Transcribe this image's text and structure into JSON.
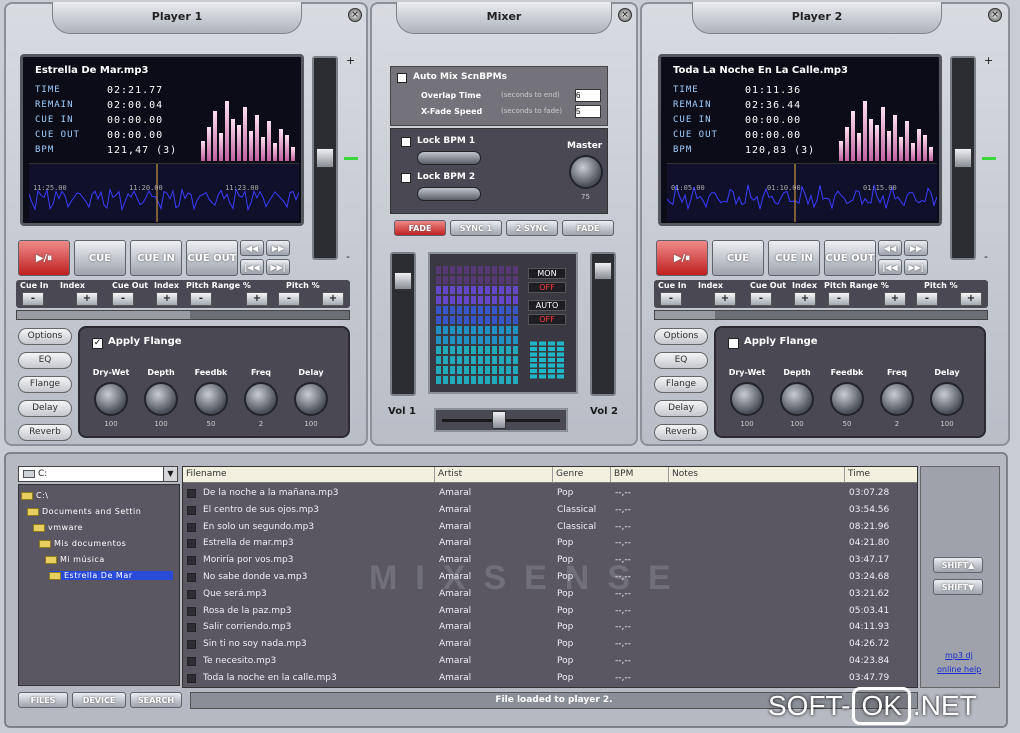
{
  "player1": {
    "title": "Player 1",
    "track": "Estrella De Mar.mp3",
    "rows": [
      {
        "label": "TIME",
        "value": "02:21.77"
      },
      {
        "label": "REMAIN",
        "value": "02:00.04"
      },
      {
        "label": "CUE IN",
        "value": "00:00.00"
      },
      {
        "label": "CUE OUT",
        "value": "00:00.00"
      },
      {
        "label": "BPM",
        "value": "121,47 (3)"
      }
    ],
    "wave_ticks": [
      "11:25.00",
      "11:20.00",
      "11:23.00"
    ],
    "apply_flange": "Apply Flange",
    "flange_checked": true
  },
  "player2": {
    "title": "Player 2",
    "track": "Toda La Noche En La Calle.mp3",
    "rows": [
      {
        "label": "TIME",
        "value": "01:11.36"
      },
      {
        "label": "REMAIN",
        "value": "02:36.44"
      },
      {
        "label": "CUE IN",
        "value": "00:00.00"
      },
      {
        "label": "CUE OUT",
        "value": "00:00.00"
      },
      {
        "label": "BPM",
        "value": "120,83 (3)"
      }
    ],
    "wave_ticks": [
      "01:05.00",
      "01:10.00",
      "01:15.00"
    ],
    "apply_flange": "Apply Flange",
    "flange_checked": false
  },
  "transport": {
    "play": "▶/⏸",
    "cue": "CUE",
    "cue_in": "CUE IN",
    "cue_out": "CUE OUT",
    "cue_in_label": "Cue In",
    "index_label": "Index",
    "cue_out_label": "Cue Out",
    "pitch_range_label": "Pitch Range %",
    "pitch_label": "Pitch %",
    "minus": "-",
    "plus": "+"
  },
  "effects": [
    "Options",
    "EQ",
    "Flange",
    "Delay",
    "Reverb"
  ],
  "knobs": [
    {
      "label": "Dry-Wet",
      "value": "100"
    },
    {
      "label": "Depth",
      "value": "100"
    },
    {
      "label": "Feedbk",
      "value": "50"
    },
    {
      "label": "Freq",
      "value": "2"
    },
    {
      "label": "Delay",
      "value": "100"
    }
  ],
  "mixer": {
    "title": "Mixer",
    "auto_mix": "Auto Mix ScnBPMs",
    "overlap_time": "Overlap Time",
    "overlap_hint": "(seconds to end)",
    "xfade_speed": "X-Fade Speed",
    "xfade_hint": "(seconds to fade)",
    "overlap_value": "6",
    "xfade_value": "5",
    "lock_bpm1": "Lock BPM 1",
    "lock_bpm2": "Lock BPM 2",
    "master": "Master",
    "master_value": "75",
    "fade_left": "FADE",
    "sync1": "SYNC 1",
    "sync2": "2 SYNC",
    "fade_right": "FADE",
    "mon": "MON",
    "off1": "OFF",
    "auto": "AUTO",
    "off2": "OFF",
    "vol1": "Vol 1",
    "vol2": "Vol 2"
  },
  "drive": "C:",
  "tree": [
    "C:\\",
    "Documents and Settin",
    "vmware",
    "Mis documentos",
    "Mi música",
    "Estrella De Mar"
  ],
  "columns": [
    "Filename",
    "Artist",
    "Genre",
    "BPM",
    "Notes",
    "Time"
  ],
  "tracks": [
    {
      "file": "De la noche a la mañana.mp3",
      "artist": "Amaral",
      "genre": "Pop",
      "bpm": "--,--",
      "time": "03:07.28"
    },
    {
      "file": "El centro de sus ojos.mp3",
      "artist": "Amaral",
      "genre": "Classical",
      "bpm": "--,--",
      "time": "03:54.56"
    },
    {
      "file": "En solo un segundo.mp3",
      "artist": "Amaral",
      "genre": "Classical",
      "bpm": "--,--",
      "time": "08:21.96"
    },
    {
      "file": "Estrella de mar.mp3",
      "artist": "Amaral",
      "genre": "Pop",
      "bpm": "--,--",
      "time": "04:21.80"
    },
    {
      "file": "Moriría por vos.mp3",
      "artist": "Amaral",
      "genre": "Pop",
      "bpm": "--,--",
      "time": "03:47.17"
    },
    {
      "file": "No sabe donde va.mp3",
      "artist": "Amaral",
      "genre": "Pop",
      "bpm": "--,--",
      "time": "03:24.68"
    },
    {
      "file": "Que será.mp3",
      "artist": "Amaral",
      "genre": "Pop",
      "bpm": "--,--",
      "time": "03:21.62"
    },
    {
      "file": "Rosa de la paz.mp3",
      "artist": "Amaral",
      "genre": "Pop",
      "bpm": "--,--",
      "time": "05:03.41"
    },
    {
      "file": "Salir corriendo.mp3",
      "artist": "Amaral",
      "genre": "Pop",
      "bpm": "--,--",
      "time": "04:11.93"
    },
    {
      "file": "Sin ti no soy nada.mp3",
      "artist": "Amaral",
      "genre": "Pop",
      "bpm": "--,--",
      "time": "04:26.72"
    },
    {
      "file": "Te necesito.mp3",
      "artist": "Amaral",
      "genre": "Pop",
      "bpm": "--,--",
      "time": "04:23.84"
    },
    {
      "file": "Toda la noche en la calle.mp3",
      "artist": "Amaral",
      "genre": "Pop",
      "bpm": "--,--",
      "time": "03:47.79"
    }
  ],
  "watermark": "MIXSENSE",
  "shift_up": "SHIFT▲",
  "shift_down": "SHIFT▼",
  "help_link1": "mp3 dj",
  "help_link2": "online help",
  "bottom_tabs": [
    "FILES",
    "DEVICE",
    "SEARCH"
  ],
  "status": "File loaded to player 2.",
  "site_badge": {
    "left": "SOFT-",
    "mid": "OK",
    "right": ".NET"
  }
}
